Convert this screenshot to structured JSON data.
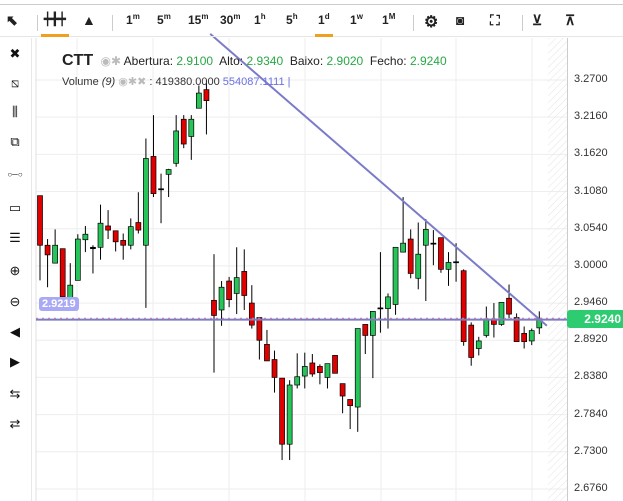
{
  "toolbar": {
    "chart_types": [
      {
        "name": "candles",
        "icon": "candlestick-icon"
      },
      {
        "name": "area",
        "icon": "mountain-icon"
      }
    ],
    "intervals": [
      {
        "n": "1",
        "u": "m"
      },
      {
        "n": "5",
        "u": "m"
      },
      {
        "n": "15",
        "u": "m"
      },
      {
        "n": "30",
        "u": "m"
      },
      {
        "n": "1",
        "u": "h"
      },
      {
        "n": "5",
        "u": "h"
      },
      {
        "n": "1",
        "u": "d"
      },
      {
        "n": "1",
        "u": "w"
      },
      {
        "n": "1",
        "u": "M"
      }
    ],
    "active_interval": "1d",
    "actions": [
      "gear-icon",
      "camera-icon",
      "fullscreen-icon",
      "cloud-download-icon",
      "cloud-upload-icon"
    ]
  },
  "left_tools": [
    "close-icon",
    "remove-drawings-icon",
    "remove-studies-icon",
    "clone-icon",
    "line-tool-icon",
    "rectangle-tool-icon",
    "fib-lines-icon",
    "zoom-in-icon",
    "zoom-out-icon",
    "scroll-left-icon",
    "scroll-right-icon",
    "zoom-x-in-icon",
    "zoom-x-out-icon"
  ],
  "legend": {
    "symbol": "CTT",
    "open_label": "Abertura:",
    "open": "2.9100",
    "high_label": "Alto:",
    "high": "2.9340",
    "low_label": "Baixo:",
    "low": "2.9020",
    "close_label": "Fecho:",
    "close": "2.9240"
  },
  "volume": {
    "label": "Volume",
    "period": "(9)",
    "value": "419380.0000",
    "ma": "554087.1111"
  },
  "horizontal_line_label": "2.9219",
  "current_price": "2.9240",
  "colors": {
    "up": "#27c45a",
    "down": "#e00000",
    "line": "#7b7bc8",
    "badge": "#2ecc71"
  },
  "chart_data": {
    "type": "candlestick",
    "y_ticks": [
      "3.2700",
      "3.2160",
      "3.1620",
      "3.1080",
      "3.0540",
      "3.0000",
      "2.9460",
      "2.8920",
      "2.8380",
      "2.7840",
      "2.7300",
      "2.6760"
    ],
    "ylim": [
      2.676,
      3.27
    ],
    "ohlc": [
      [
        3.102,
        3.102,
        2.979,
        3.03
      ],
      [
        3.03,
        3.039,
        2.969,
        3.016
      ],
      [
        3.004,
        3.053,
        3.004,
        3.03
      ],
      [
        3.025,
        3.025,
        2.95,
        2.955
      ],
      [
        2.94,
        3.004,
        2.935,
        2.972
      ],
      [
        2.979,
        3.046,
        2.979,
        3.039
      ],
      [
        3.038,
        3.058,
        3.02,
        3.046
      ],
      [
        3.025,
        3.03,
        2.989,
        3.027
      ],
      [
        3.027,
        3.089,
        3.009,
        3.062
      ],
      [
        3.058,
        3.081,
        3.039,
        3.052
      ],
      [
        3.051,
        3.051,
        3.021,
        3.035
      ],
      [
        3.037,
        3.047,
        3.009,
        3.03
      ],
      [
        3.03,
        3.069,
        3.024,
        3.057
      ],
      [
        3.063,
        3.107,
        3.047,
        3.052
      ],
      [
        3.03,
        3.185,
        2.939,
        3.156
      ],
      [
        3.159,
        3.219,
        3.1,
        3.105
      ],
      [
        3.112,
        3.134,
        3.062,
        3.112
      ],
      [
        3.133,
        3.141,
        3.1,
        3.14
      ],
      [
        3.149,
        3.219,
        3.144,
        3.196
      ],
      [
        3.213,
        3.219,
        3.171,
        3.177
      ],
      [
        3.188,
        3.219,
        3.154,
        3.213
      ],
      [
        3.229,
        3.262,
        3.229,
        3.251
      ],
      [
        3.256,
        3.27,
        3.191,
        3.24
      ],
      [
        2.95,
        3.017,
        2.845,
        2.928
      ],
      [
        2.936,
        2.978,
        2.913,
        2.969
      ],
      [
        2.978,
        2.984,
        2.94,
        2.951
      ],
      [
        2.96,
        3.027,
        2.93,
        2.983
      ],
      [
        2.992,
        3.024,
        2.936,
        2.957
      ],
      [
        2.946,
        2.972,
        2.909,
        2.914
      ],
      [
        2.925,
        2.925,
        2.864,
        2.892
      ],
      [
        2.886,
        2.907,
        2.862,
        2.862
      ],
      [
        2.864,
        2.877,
        2.816,
        2.838
      ],
      [
        2.837,
        2.837,
        2.718,
        2.741
      ],
      [
        2.741,
        2.834,
        2.718,
        2.827
      ],
      [
        2.827,
        2.873,
        2.822,
        2.839
      ],
      [
        2.84,
        2.874,
        2.822,
        2.854
      ],
      [
        2.859,
        2.872,
        2.839,
        2.843
      ],
      [
        2.854,
        2.857,
        2.828,
        2.845
      ],
      [
        2.838,
        2.858,
        2.822,
        2.858
      ],
      [
        2.87,
        2.87,
        2.844,
        2.844
      ],
      [
        2.829,
        2.829,
        2.786,
        2.811
      ],
      [
        2.806,
        2.806,
        2.763,
        2.797
      ],
      [
        2.795,
        2.909,
        2.759,
        2.909
      ],
      [
        2.915,
        2.915,
        2.872,
        2.899
      ],
      [
        2.899,
        2.934,
        2.837,
        2.934
      ],
      [
        2.939,
        3.02,
        2.903,
        2.939
      ],
      [
        2.938,
        2.96,
        2.909,
        2.955
      ],
      [
        2.944,
        3.027,
        2.929,
        3.027
      ],
      [
        3.02,
        3.1,
        3.02,
        3.033
      ],
      [
        3.039,
        3.053,
        2.982,
        2.989
      ],
      [
        2.982,
        3.063,
        2.966,
        3.017
      ],
      [
        3.03,
        3.068,
        2.949,
        3.053
      ],
      [
        3.033,
        3.052,
        3.001,
        3.033
      ],
      [
        3.041,
        3.041,
        2.99,
        2.995
      ],
      [
        2.995,
        3.02,
        2.971,
        3.005
      ],
      [
        3.006,
        3.033,
        2.977,
        3.006
      ],
      [
        2.993,
        2.995,
        2.884,
        2.89
      ],
      [
        2.914,
        2.918,
        2.855,
        2.867
      ],
      [
        2.88,
        2.897,
        2.87,
        2.891
      ],
      [
        2.899,
        2.941,
        2.896,
        2.923
      ],
      [
        2.923,
        2.946,
        2.896,
        2.915
      ],
      [
        2.915,
        2.947,
        2.913,
        2.947
      ],
      [
        2.953,
        2.973,
        2.924,
        2.93
      ],
      [
        2.925,
        2.931,
        2.89,
        2.89
      ],
      [
        2.902,
        2.912,
        2.88,
        2.89
      ],
      [
        2.891,
        2.909,
        2.885,
        2.906
      ],
      [
        2.91,
        2.934,
        2.901,
        2.924
      ]
    ],
    "trendline": {
      "from_index": 22.5,
      "from_price": 3.337,
      "to_index": 67,
      "to_price": 2.913
    },
    "horizontal_line": 2.9219
  }
}
